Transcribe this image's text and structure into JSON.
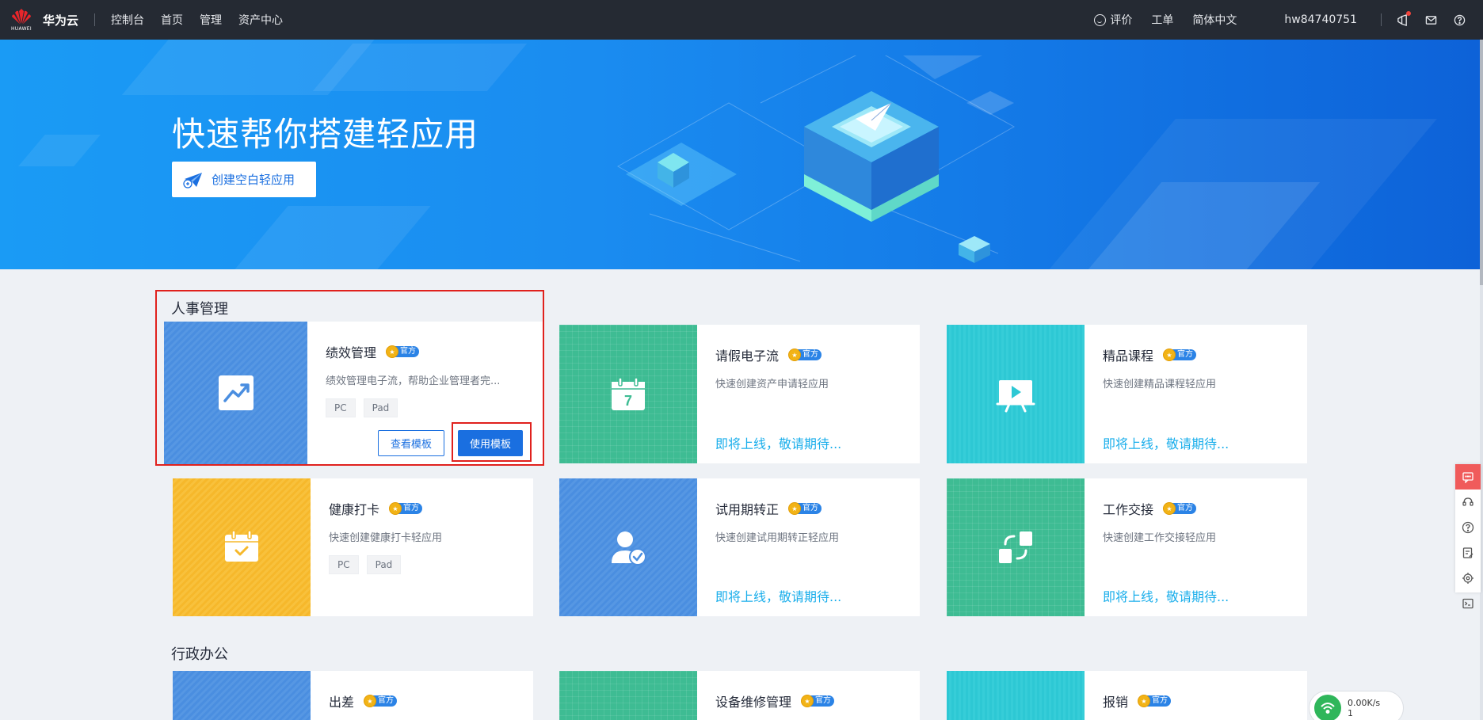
{
  "topbar": {
    "brand": "华为云",
    "logo_sub": "HUAWEI",
    "nav": [
      "控制台",
      "首页",
      "管理",
      "资产中心"
    ],
    "rate": "评价",
    "ticket": "工单",
    "language": "简体中文",
    "user": "hw84740751"
  },
  "banner": {
    "title": "快速帮你搭建轻应用",
    "create_button": "创建空白轻应用"
  },
  "sections": [
    {
      "title": "人事管理",
      "cards": [
        {
          "name": "绩效管理",
          "badge": "官方",
          "desc": "绩效管理电子流，帮助企业管理者完...",
          "tags": [
            "PC",
            "Pad"
          ],
          "view_button": "查看模板",
          "use_button": "使用模板",
          "color": "#4a8ee0",
          "icon": "chart-up-icon"
        },
        {
          "name": "请假电子流",
          "badge": "官方",
          "desc": "快速创建资产申请轻应用",
          "coming": "即将上线，敬请期待...",
          "color": "#3ebc93",
          "icon": "calendar-7-icon",
          "icon_text": "7"
        },
        {
          "name": "精品课程",
          "badge": "官方",
          "desc": "快速创建精品课程轻应用",
          "coming": "即将上线，敬请期待...",
          "color": "#2dc8d4",
          "icon": "presentation-play-icon"
        },
        {
          "name": "健康打卡",
          "badge": "官方",
          "desc": "快速创建健康打卡轻应用",
          "tags": [
            "PC",
            "Pad"
          ],
          "color": "#f6b82b",
          "icon": "calendar-check-icon"
        },
        {
          "name": "试用期转正",
          "badge": "官方",
          "desc": "快速创建试用期转正轻应用",
          "coming": "即将上线，敬请期待...",
          "color": "#4a8ee0",
          "icon": "user-check-icon"
        },
        {
          "name": "工作交接",
          "badge": "官方",
          "desc": "快速创建工作交接轻应用",
          "coming": "即将上线，敬请期待...",
          "color": "#3ebc93",
          "icon": "handover-icon"
        }
      ]
    },
    {
      "title": "行政办公",
      "cards": [
        {
          "name": "出差",
          "badge": "官方",
          "color": "#4a8ee0"
        },
        {
          "name": "设备维修管理",
          "badge": "官方",
          "color": "#3ebc93"
        },
        {
          "name": "报销",
          "badge": "官方",
          "color": "#2dc8d4"
        }
      ]
    }
  ],
  "network": {
    "speed": "0.00K/s",
    "count": "1"
  }
}
